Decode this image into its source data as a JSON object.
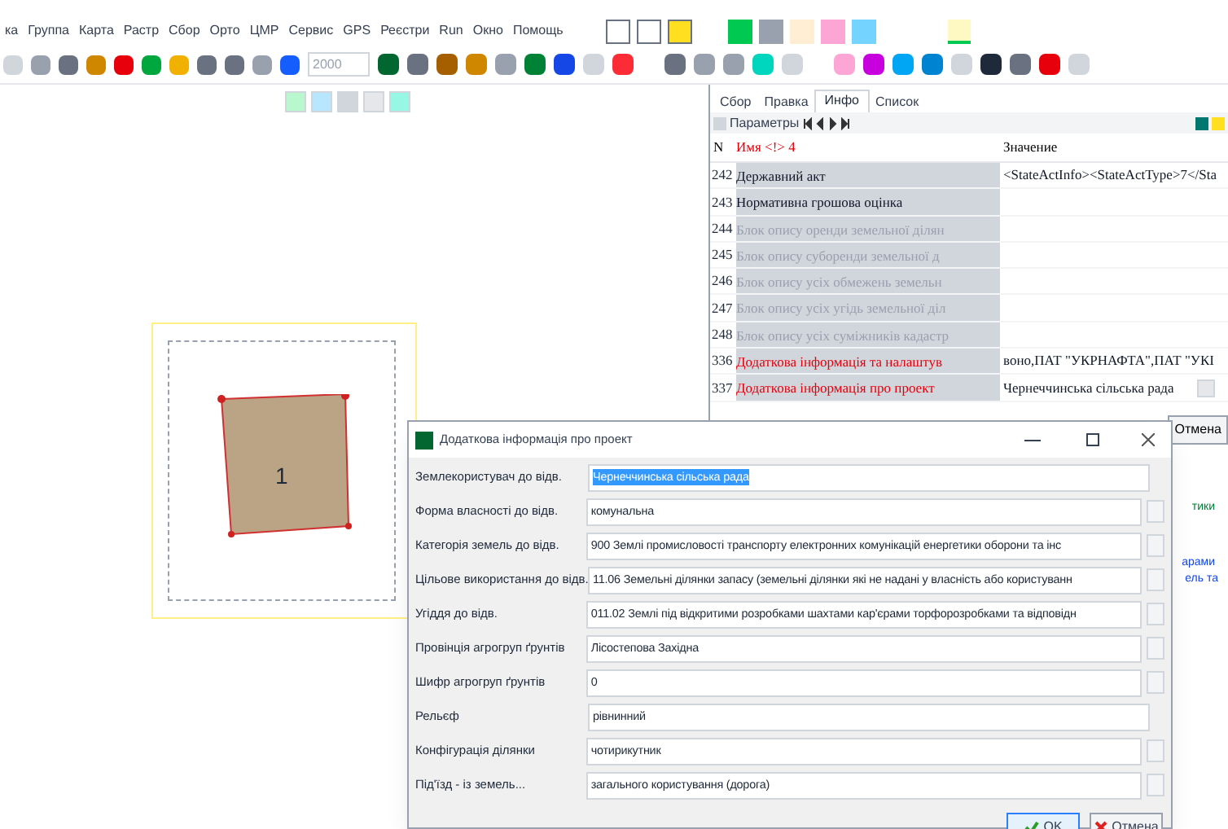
{
  "menu": [
    "ка",
    "Группа",
    "Карта",
    "Растр",
    "Сбор",
    "Орто",
    "ЦМР",
    "Сервис",
    "GPS",
    "Реєстри",
    "Run",
    "Окно",
    "Помощь"
  ],
  "toolbar": {
    "year_field": "2000"
  },
  "canvas": {
    "parcel_label": "1"
  },
  "info_panel": {
    "tabs": [
      {
        "label": "Сбор",
        "selected": false
      },
      {
        "label": "Правка",
        "selected": false
      },
      {
        "label": "Инфо",
        "selected": true
      },
      {
        "label": "Список",
        "selected": false
      }
    ],
    "toolbar_label": "Параметры",
    "columns": [
      "N",
      "Имя <!> 4",
      "Значение"
    ],
    "rows": [
      {
        "n": "242",
        "name": "Державний акт",
        "value": "<StateActInfo><StateActType>7</Sta",
        "kind": "normal"
      },
      {
        "n": "243",
        "name": "Нормативна грошова оцінка",
        "kind": "normal"
      },
      {
        "n": "244",
        "name": "Блок опису оренди земельної ділян",
        "kind": "disabled"
      },
      {
        "n": "245",
        "name": "Блок опису суборенди земельної д",
        "kind": "disabled"
      },
      {
        "n": "246",
        "name": "Блок опису усіх обмежень земельн",
        "kind": "disabled"
      },
      {
        "n": "247",
        "name": "Блок опису усіх угідь земельної діл",
        "kind": "disabled"
      },
      {
        "n": "248",
        "name": "Блок опису усіх суміжників кадастр",
        "kind": "disabled"
      },
      {
        "n": "336",
        "name": "Додаткова інформація та налаштув",
        "value": "воно,ПАТ \"УКРНАФТА\",ПАТ \"УКІ",
        "kind": "required"
      },
      {
        "n": "337",
        "name": "Додаткова інформація про проект",
        "value": "Чернеччинська сільська рада",
        "kind": "required",
        "browse_button": true
      }
    ]
  },
  "background_panel": {
    "button": "Отмена",
    "texts": [
      "тики",
      "арами",
      "ель та"
    ]
  },
  "dialog": {
    "title": "Додаткова інформація про проект",
    "fields": [
      {
        "label": "Землекористувач до відв.",
        "value": "Чернеччинська сільська рада",
        "selected": true,
        "browse_button": false
      },
      {
        "label": "Форма власності до відв.",
        "value": "комунальна",
        "selected": false,
        "browse_button": true
      },
      {
        "label": "Категорія земель до відв.",
        "value": "900 Землі промисловості транспорту електронних комунікацій енергетики оборони та інс",
        "selected": false,
        "browse_button": true
      },
      {
        "label": "Цільове використання до відв.",
        "value": "11.06 Земельні ділянки запасу (земельні ділянки які не надані у власність або користуванн",
        "selected": false,
        "browse_button": true
      },
      {
        "label": "Угіддя до відв.",
        "value": "011.02 Землі під відкритими розробками шахтами кар'єрами торфорозробками та відповідн",
        "selected": false,
        "browse_button": true
      },
      {
        "label": "Провінція агрогруп ґрунтів",
        "value": "Лісостепова Західна",
        "selected": false,
        "browse_button": true
      },
      {
        "label": "Шифр агрогруп ґрунтів",
        "value": "0",
        "selected": false,
        "browse_button": true
      },
      {
        "label": "Рельєф",
        "value": "рівнинний",
        "selected": false,
        "browse_button": false
      },
      {
        "label": "Конфігурація ділянки",
        "value": "чотирикутник",
        "selected": false,
        "browse_button": true
      },
      {
        "label": "Під'їзд - із земель...",
        "value": "загального користування (дорога)",
        "selected": false,
        "browse_button": true
      }
    ],
    "buttons": [
      {
        "label": "OK",
        "kind": "ok"
      },
      {
        "label": "Отмена",
        "kind": "cancel"
      }
    ]
  }
}
